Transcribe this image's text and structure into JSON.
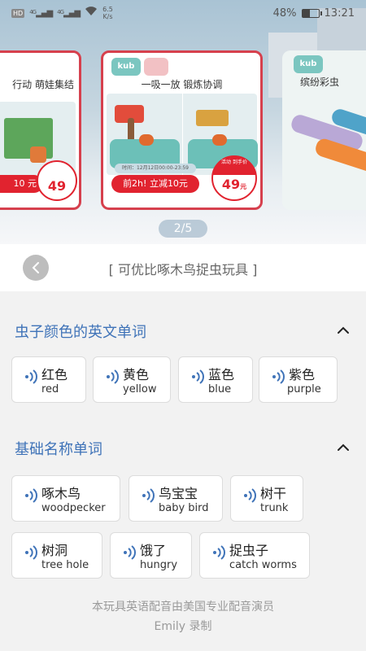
{
  "status_bar": {
    "hd_label": "HD",
    "net1": "4G",
    "net2": "4G",
    "speed_value": "6.5",
    "speed_unit": "K/s",
    "battery_percent": "48%",
    "battery_level": 0.48,
    "time": "13:21"
  },
  "banner": {
    "left_card_title": "行动 萌娃集结",
    "left_card_cta": "10 元",
    "left_card_price": "49",
    "main_card_logo": "kub",
    "main_card_title": "一吸一放 锻炼协调",
    "main_card_time": "时间：12月12日00:00-23:59",
    "main_card_cta": "前2h! 立减10元",
    "main_card_price_label": "活动 到手价",
    "main_card_price": "49",
    "main_card_price_unit": "元",
    "right_card_logo": "kub",
    "right_card_title": "缤纷彩虫",
    "pager": "2/5"
  },
  "header": {
    "title": "[ 可优比啄木鸟捉虫玩具 ]"
  },
  "sections": [
    {
      "title": "虫子颜色的英文单词",
      "words": [
        {
          "cn": "红色",
          "en": "red"
        },
        {
          "cn": "黄色",
          "en": "yellow"
        },
        {
          "cn": "蓝色",
          "en": "blue"
        },
        {
          "cn": "紫色",
          "en": "purple"
        }
      ]
    },
    {
      "title": "基础名称单词",
      "words": [
        {
          "cn": "啄木鸟",
          "en": "woodpecker"
        },
        {
          "cn": "鸟宝宝",
          "en": "baby bird"
        },
        {
          "cn": "树干",
          "en": "trunk"
        },
        {
          "cn": "树洞",
          "en": "tree hole"
        },
        {
          "cn": "饿了",
          "en": "hungry"
        },
        {
          "cn": "捉虫子",
          "en": "catch worms"
        }
      ]
    }
  ],
  "footer": {
    "line1": "本玩具英语配音由美国专业配音演员",
    "line2": "Emily 录制"
  },
  "colors": {
    "accent_blue": "#3f73b8",
    "banner_red": "#e1232f",
    "speaker_blue": "#3f73b8"
  },
  "icons": {
    "back": "chevron-left-icon",
    "collapse": "chevron-up-icon",
    "speaker": "sound-wave-icon"
  }
}
